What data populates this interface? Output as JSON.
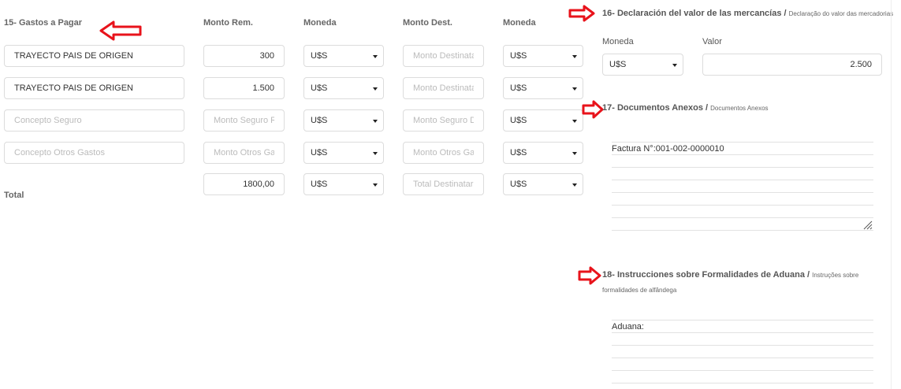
{
  "section15": {
    "title": "15- Gastos a Pagar",
    "headers": {
      "monto_rem": "Monto Rem.",
      "moneda1": "Moneda",
      "monto_dest": "Monto Dest.",
      "moneda2": "Moneda"
    },
    "rows": [
      {
        "concept": "TRAYECTO PAIS DE ORIGEN",
        "concept_ph": "",
        "monto_rem": "300",
        "monto_rem_ph": "",
        "moneda1": "U$S",
        "monto_dest": "",
        "monto_dest_ph": "Monto Destinata",
        "moneda2": "U$S"
      },
      {
        "concept": "TRAYECTO PAIS DE ORIGEN",
        "concept_ph": "",
        "monto_rem": "1.500",
        "monto_rem_ph": "",
        "moneda1": "U$S",
        "monto_dest": "",
        "monto_dest_ph": "Monto Destinata",
        "moneda2": "U$S"
      },
      {
        "concept": "",
        "concept_ph": "Concepto Seguro",
        "monto_rem": "",
        "monto_rem_ph": "Monto Seguro Re",
        "moneda1": "U$S",
        "monto_dest": "",
        "monto_dest_ph": "Monto Seguro D",
        "moneda2": "U$S"
      },
      {
        "concept": "",
        "concept_ph": "Concepto Otros Gastos",
        "monto_rem": "",
        "monto_rem_ph": "Monto Otros Gas",
        "moneda1": "U$S",
        "monto_dest": "",
        "monto_dest_ph": "Monto Otros Gas",
        "moneda2": "U$S"
      }
    ],
    "total": {
      "label": "Total",
      "monto_rem": "1800,00",
      "moneda1": "U$S",
      "monto_dest_ph": "Total Destinatari",
      "moneda2": "U$S"
    }
  },
  "section16": {
    "title": "16- Declaración del valor de las mercancías",
    "sep": " / ",
    "subtitle": "Declaração do valor das mercadorias",
    "moneda_label": "Moneda",
    "moneda_value": "U$S",
    "valor_label": "Valor",
    "valor_value": "2.500"
  },
  "section17": {
    "title": "17- Documentos Anexos",
    "sep": " / ",
    "subtitle": "Documentos Anexos",
    "text": "Factura N°:001-002-0000010"
  },
  "section18": {
    "title": "18- Instrucciones sobre Formalidades de Aduana",
    "sep": " / ",
    "subtitle": "Instruções sobre formalidades de alfândega",
    "text": "Aduana:"
  },
  "colors": {
    "arrow": "#e8131b",
    "border": "#dcdcdc",
    "placeholder": "#bbbbbb"
  },
  "icons": [
    "arrow-left-icon",
    "arrow-right-icon",
    "chevron-down-icon",
    "resize-handle-icon"
  ]
}
